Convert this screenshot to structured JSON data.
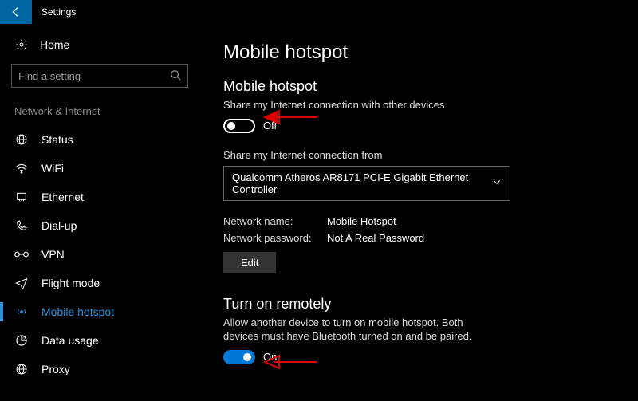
{
  "app": {
    "title": "Settings"
  },
  "sidebar": {
    "home": "Home",
    "search_placeholder": "Find a setting",
    "group_label": "Network & Internet",
    "items": [
      {
        "label": "Status"
      },
      {
        "label": "WiFi"
      },
      {
        "label": "Ethernet"
      },
      {
        "label": "Dial-up"
      },
      {
        "label": "VPN"
      },
      {
        "label": "Flight mode"
      },
      {
        "label": "Mobile hotspot"
      },
      {
        "label": "Data usage"
      },
      {
        "label": "Proxy"
      }
    ]
  },
  "page": {
    "title": "Mobile hotspot",
    "hotspot": {
      "heading": "Mobile hotspot",
      "desc": "Share my Internet connection with other devices",
      "toggle_state": "Off",
      "share_from_label": "Share my Internet connection from",
      "adapter": "Qualcomm Atheros AR8171 PCI-E Gigabit Ethernet Controller",
      "name_label": "Network name:",
      "name_value": "Mobile Hotspot",
      "pwd_label": "Network password:",
      "pwd_value": "Not A Real Password",
      "edit": "Edit"
    },
    "remote": {
      "heading": "Turn on remotely",
      "desc": "Allow another device to turn on mobile hotspot. Both devices must have Bluetooth turned on and be paired.",
      "toggle_state": "On"
    }
  }
}
